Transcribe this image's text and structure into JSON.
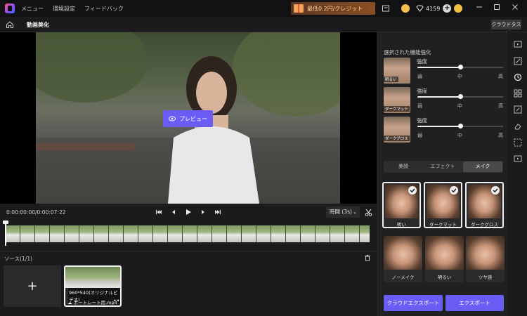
{
  "titlebar": {
    "menu": [
      "メニュー",
      "環境設定",
      "フィードバック"
    ],
    "promo_text": "最低0.2円/クレジット",
    "credits": "4159"
  },
  "subheader": {
    "page_title": "動画美化",
    "cloud_task": "クラウドタスク"
  },
  "preview": {
    "button_label": "プレビュー"
  },
  "controls": {
    "timecode": "0:00:00:00/0:00:07:22",
    "time_select": "時間 (3s)"
  },
  "source": {
    "label": "ソース(1/1)",
    "add": "+",
    "clip": {
      "resolution": "960*540(オリジナルビデオ)",
      "name": "ポートレート用.mp4",
      "more": "•••"
    }
  },
  "panel": {
    "heading": "選択された機能強化",
    "enhancements": [
      {
        "tag": "明るい",
        "label": "強度",
        "value": 0.5,
        "scale": [
          "弱",
          "中",
          "高"
        ]
      },
      {
        "tag": "ダークマット",
        "label": "強度",
        "value": 0.5,
        "scale": [
          "弱",
          "中",
          "高"
        ]
      },
      {
        "tag": "ダークグロス",
        "label": "強度",
        "value": 0.5,
        "scale": [
          "弱",
          "中",
          "高"
        ]
      }
    ],
    "tabs": [
      "美顔",
      "エフェクト",
      "メイク"
    ],
    "active_tab": "メイク",
    "makeup": [
      {
        "label": "明い",
        "selected": true
      },
      {
        "label": "ダークマット",
        "selected": true
      },
      {
        "label": "ダークグロス",
        "selected": true
      },
      {
        "label": "ノーメイク",
        "selected": false
      },
      {
        "label": "明るい",
        "selected": false
      },
      {
        "label": "ツヤ感",
        "selected": false
      }
    ],
    "cloud_export": "クラウドエクスポート",
    "export": "エクスポート"
  },
  "colors": {
    "accent": "#6c5cf6",
    "background": "#1b1b1d",
    "panel": "#202022"
  }
}
